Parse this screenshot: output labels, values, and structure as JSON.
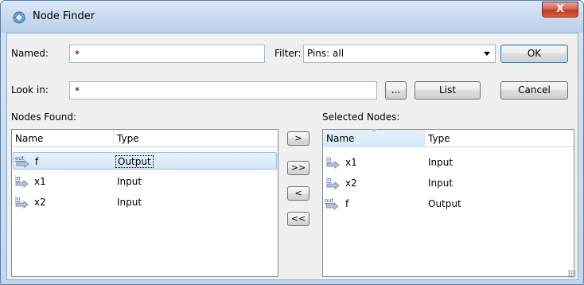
{
  "window": {
    "title": "Node Finder",
    "close_label": "X"
  },
  "form": {
    "named_label": "Named:",
    "named_value": "*",
    "filter_label": "Filter:",
    "filter_value": "Pins: all",
    "look_in_label": "Look in:",
    "look_in_value": "*",
    "browse_label": "...",
    "list_label": "List",
    "ok_label": "OK",
    "cancel_label": "Cancel"
  },
  "nodes_found": {
    "label": "Nodes Found:",
    "columns": [
      "Name",
      "Type"
    ],
    "rows": [
      {
        "icon": "out",
        "name": "f",
        "type": "Output"
      },
      {
        "icon": "in",
        "name": "x1",
        "type": "Input"
      },
      {
        "icon": "in",
        "name": "x2",
        "type": "Input"
      }
    ]
  },
  "transfer": {
    "add_one": ">",
    "add_all": ">>",
    "remove_one": "<",
    "remove_all": "<<"
  },
  "selected_nodes": {
    "label": "Selected Nodes:",
    "columns": [
      "Name",
      "Type"
    ],
    "rows": [
      {
        "icon": "in",
        "name": "x1",
        "type": "Input"
      },
      {
        "icon": "in",
        "name": "x2",
        "type": "Input"
      },
      {
        "icon": "out",
        "name": "f",
        "type": "Output"
      }
    ]
  },
  "colors": {
    "selection": "#d3e6f8",
    "pin_in": "#1f4fbf",
    "pin_out": "#1f4fbf"
  }
}
